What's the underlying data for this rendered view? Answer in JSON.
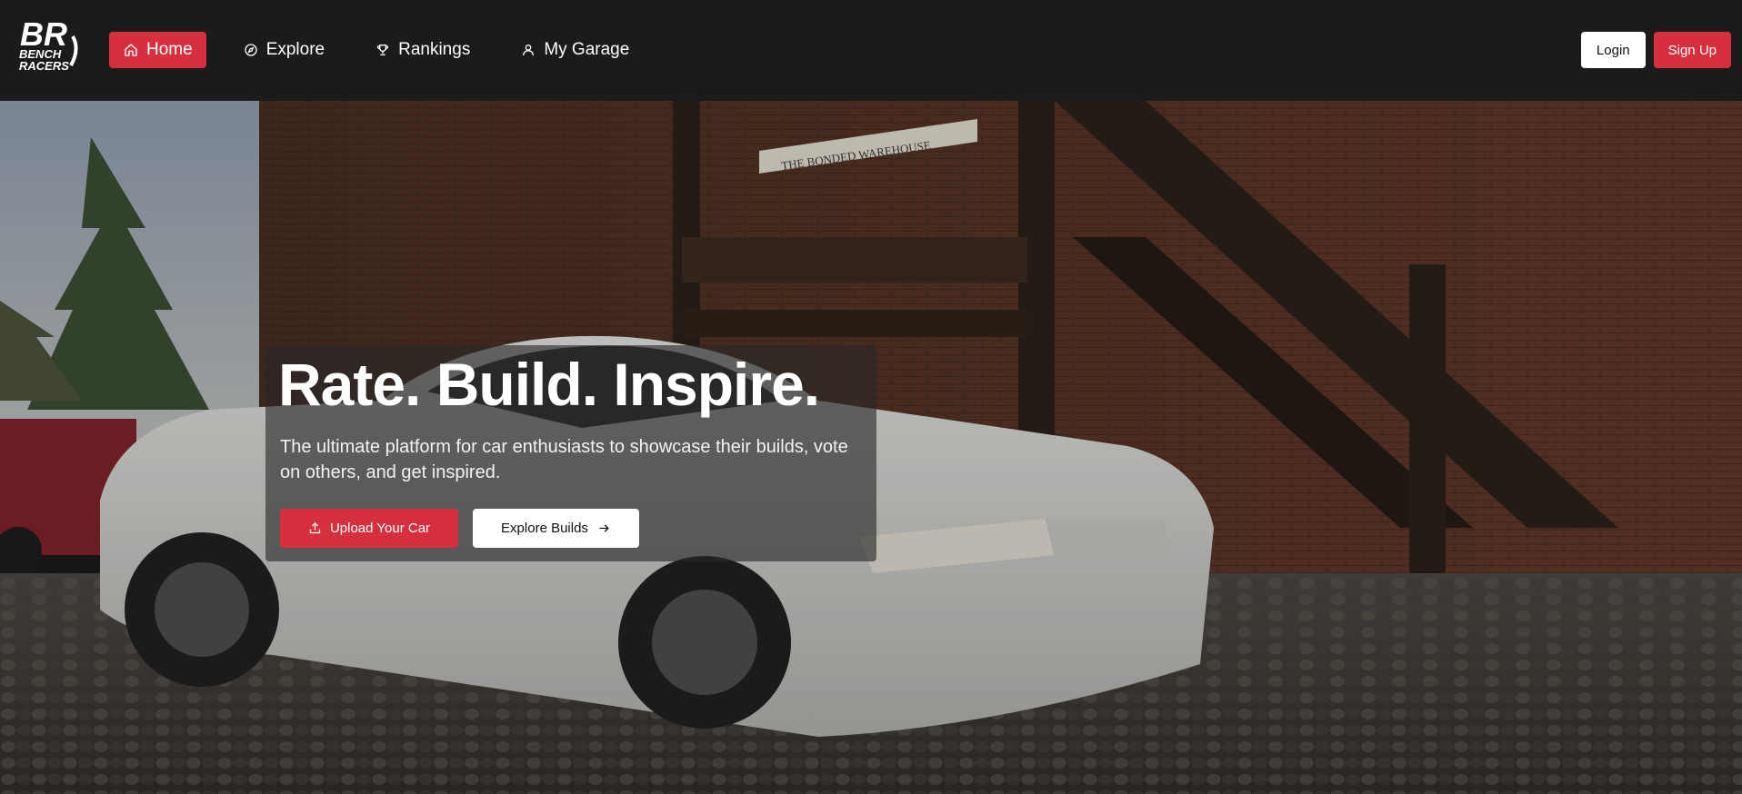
{
  "brand": {
    "logo_text_top": "BR",
    "logo_text_bottom_1": "BENCH",
    "logo_text_bottom_2": "RACERS"
  },
  "nav": {
    "items": [
      {
        "label": "Home",
        "icon": "home-icon",
        "active": true
      },
      {
        "label": "Explore",
        "icon": "compass-icon",
        "active": false
      },
      {
        "label": "Rankings",
        "icon": "trophy-icon",
        "active": false
      },
      {
        "label": "My Garage",
        "icon": "user-icon",
        "active": false
      }
    ]
  },
  "auth": {
    "login_label": "Login",
    "signup_label": "Sign Up"
  },
  "hero": {
    "title": "Rate. Build. Inspire.",
    "subtitle": "The ultimate platform for car enthusiasts to showcase their builds, vote on others, and get inspired.",
    "upload_label": "Upload Your Car",
    "explore_label": "Explore Builds",
    "sign_text": "THE BONDED WAREHOUSE"
  },
  "colors": {
    "accent": "#d6303f",
    "navbar": "#1b1b1b"
  }
}
